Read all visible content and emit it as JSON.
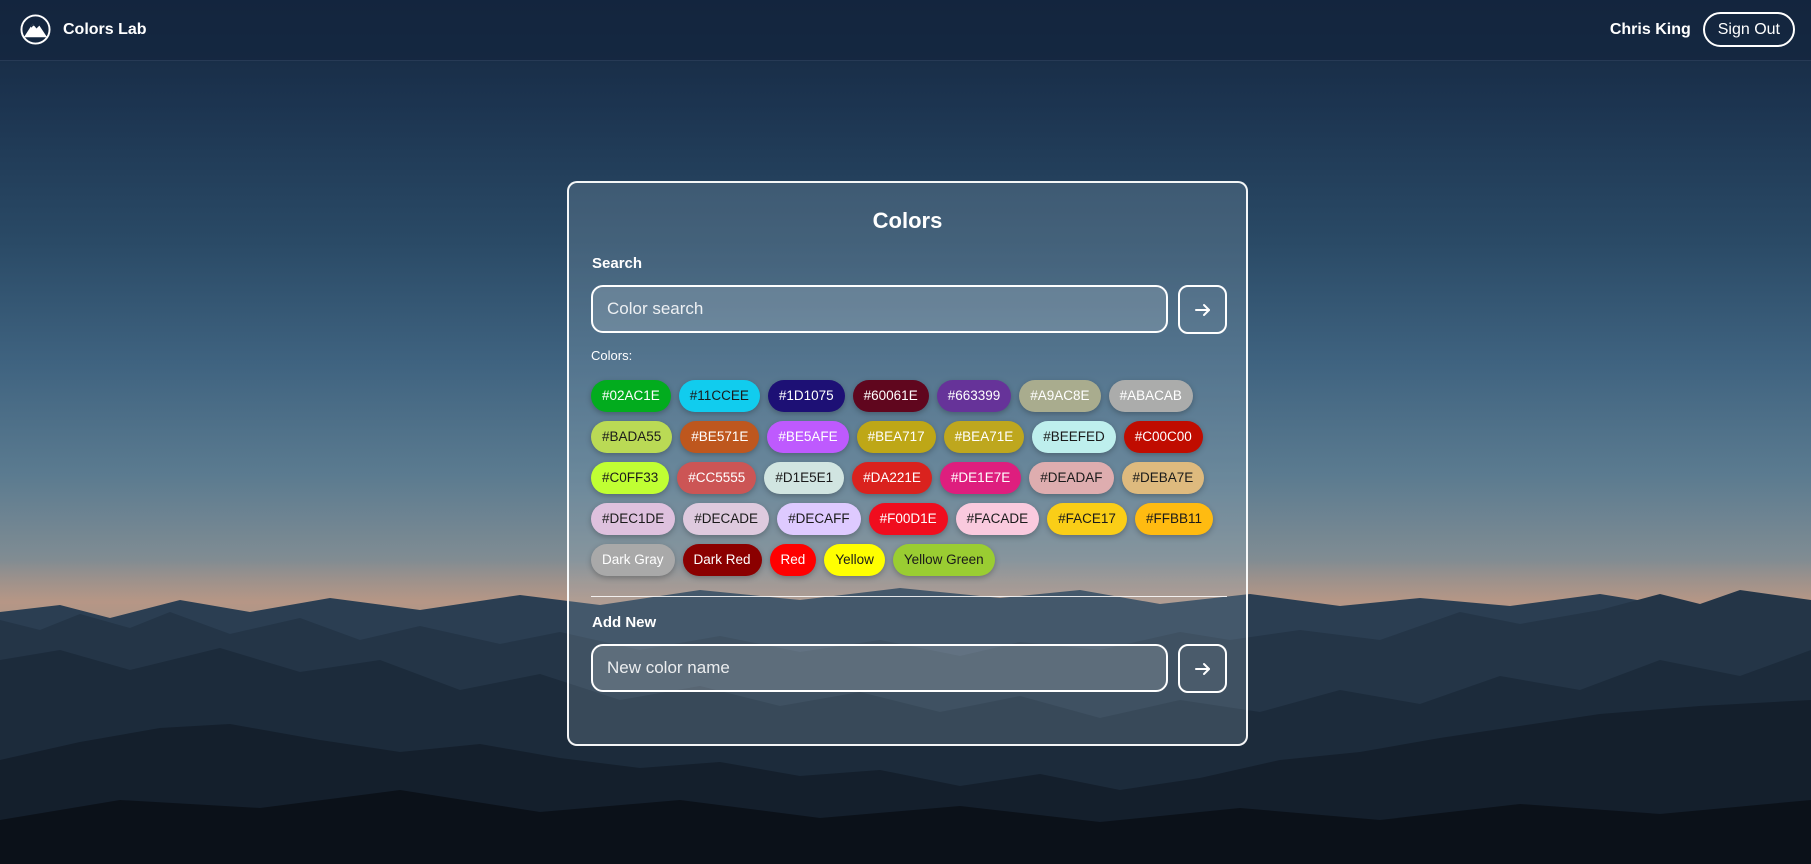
{
  "header": {
    "app_name": "Colors Lab",
    "logo_icon": "mountain-logo-icon",
    "user_name": "Chris King",
    "sign_out_label": "Sign Out"
  },
  "card": {
    "title": "Colors",
    "search": {
      "label": "Search",
      "placeholder": "Color search",
      "submit_icon": "arrow-right-icon"
    },
    "colors_caption": "Colors:",
    "colors": [
      {
        "label": "#02AC1E",
        "bg": "#02AC1E",
        "fg": "#ffffff"
      },
      {
        "label": "#11CCEE",
        "bg": "#11CCEE",
        "fg": "#1a1a1a"
      },
      {
        "label": "#1D1075",
        "bg": "#1D1075",
        "fg": "#ffffff"
      },
      {
        "label": "#60061E",
        "bg": "#60061E",
        "fg": "#ffffff"
      },
      {
        "label": "#663399",
        "bg": "#663399",
        "fg": "#ffffff"
      },
      {
        "label": "#A9AC8E",
        "bg": "#A9AC8E",
        "fg": "#ffffff"
      },
      {
        "label": "#ABACAB",
        "bg": "#ABACAB",
        "fg": "#ffffff"
      },
      {
        "label": "#BADA55",
        "bg": "#BADA55",
        "fg": "#1a1a1a"
      },
      {
        "label": "#BE571E",
        "bg": "#BE571E",
        "fg": "#ffffff"
      },
      {
        "label": "#BE5AFE",
        "bg": "#BE5AFE",
        "fg": "#ffffff"
      },
      {
        "label": "#BEA717",
        "bg": "#BEA717",
        "fg": "#ffffff"
      },
      {
        "label": "#BEA71E",
        "bg": "#BEA71E",
        "fg": "#ffffff"
      },
      {
        "label": "#BEEFED",
        "bg": "#BEEFED",
        "fg": "#1a1a1a"
      },
      {
        "label": "#C00C00",
        "bg": "#C00C00",
        "fg": "#ffffff"
      },
      {
        "label": "#C0FF33",
        "bg": "#C0FF33",
        "fg": "#1a1a1a"
      },
      {
        "label": "#CC5555",
        "bg": "#CC5555",
        "fg": "#ffffff"
      },
      {
        "label": "#D1E5E1",
        "bg": "#D1E5E1",
        "fg": "#1a1a1a"
      },
      {
        "label": "#DA221E",
        "bg": "#DA221E",
        "fg": "#ffffff"
      },
      {
        "label": "#DE1E7E",
        "bg": "#DE1E7E",
        "fg": "#ffffff"
      },
      {
        "label": "#DEADAF",
        "bg": "#DEADAF",
        "fg": "#1a1a1a"
      },
      {
        "label": "#DEBA7E",
        "bg": "#DEBA7E",
        "fg": "#1a1a1a"
      },
      {
        "label": "#DEC1DE",
        "bg": "#DEC1DE",
        "fg": "#1a1a1a"
      },
      {
        "label": "#DECADE",
        "bg": "#DECADE",
        "fg": "#1a1a1a"
      },
      {
        "label": "#DECAFF",
        "bg": "#DECAFF",
        "fg": "#1a1a1a"
      },
      {
        "label": "#F00D1E",
        "bg": "#F00D1E",
        "fg": "#ffffff"
      },
      {
        "label": "#FACADE",
        "bg": "#FACADE",
        "fg": "#1a1a1a"
      },
      {
        "label": "#FACE17",
        "bg": "#FACE17",
        "fg": "#1a1a1a"
      },
      {
        "label": "#FFBB11",
        "bg": "#FFBB11",
        "fg": "#1a1a1a"
      },
      {
        "label": "Dark Gray",
        "bg": "#A9A9A9",
        "fg": "#ffffff"
      },
      {
        "label": "Dark Red",
        "bg": "#8B0000",
        "fg": "#ffffff"
      },
      {
        "label": "Red",
        "bg": "#FF0000",
        "fg": "#ffffff"
      },
      {
        "label": "Yellow",
        "bg": "#FFFF00",
        "fg": "#1a1a1a"
      },
      {
        "label": "Yellow Green",
        "bg": "#9ACD32",
        "fg": "#1a1a1a"
      }
    ],
    "add_new": {
      "label": "Add New",
      "placeholder": "New color name",
      "submit_icon": "arrow-right-icon"
    }
  }
}
